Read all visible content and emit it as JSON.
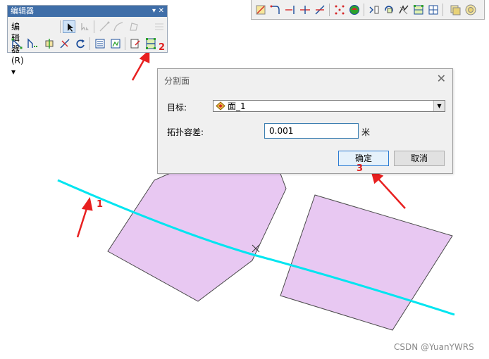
{
  "editor_toolbar": {
    "title": "编辑器",
    "pin_glyph": "▾",
    "close_glyph": "✕",
    "menu_label": "编辑器(R)",
    "menu_arrow": "▾"
  },
  "dialog": {
    "title": "分割面",
    "close_glyph": "✕",
    "target_label": "目标:",
    "target_value": "面_1",
    "tolerance_label": "拓扑容差:",
    "tolerance_value": "0.001",
    "unit": "米",
    "ok_label": "确定",
    "cancel_label": "取消"
  },
  "annotations": {
    "step1": "1",
    "step2": "2",
    "step3": "3"
  },
  "colors": {
    "polygon_fill": "#e8c8f2",
    "polygon_stroke": "#4a4a4a",
    "split_line": "#00e5f0",
    "arrow_red": "#e82020"
  },
  "watermark": "CSDN @YuanYWRS"
}
